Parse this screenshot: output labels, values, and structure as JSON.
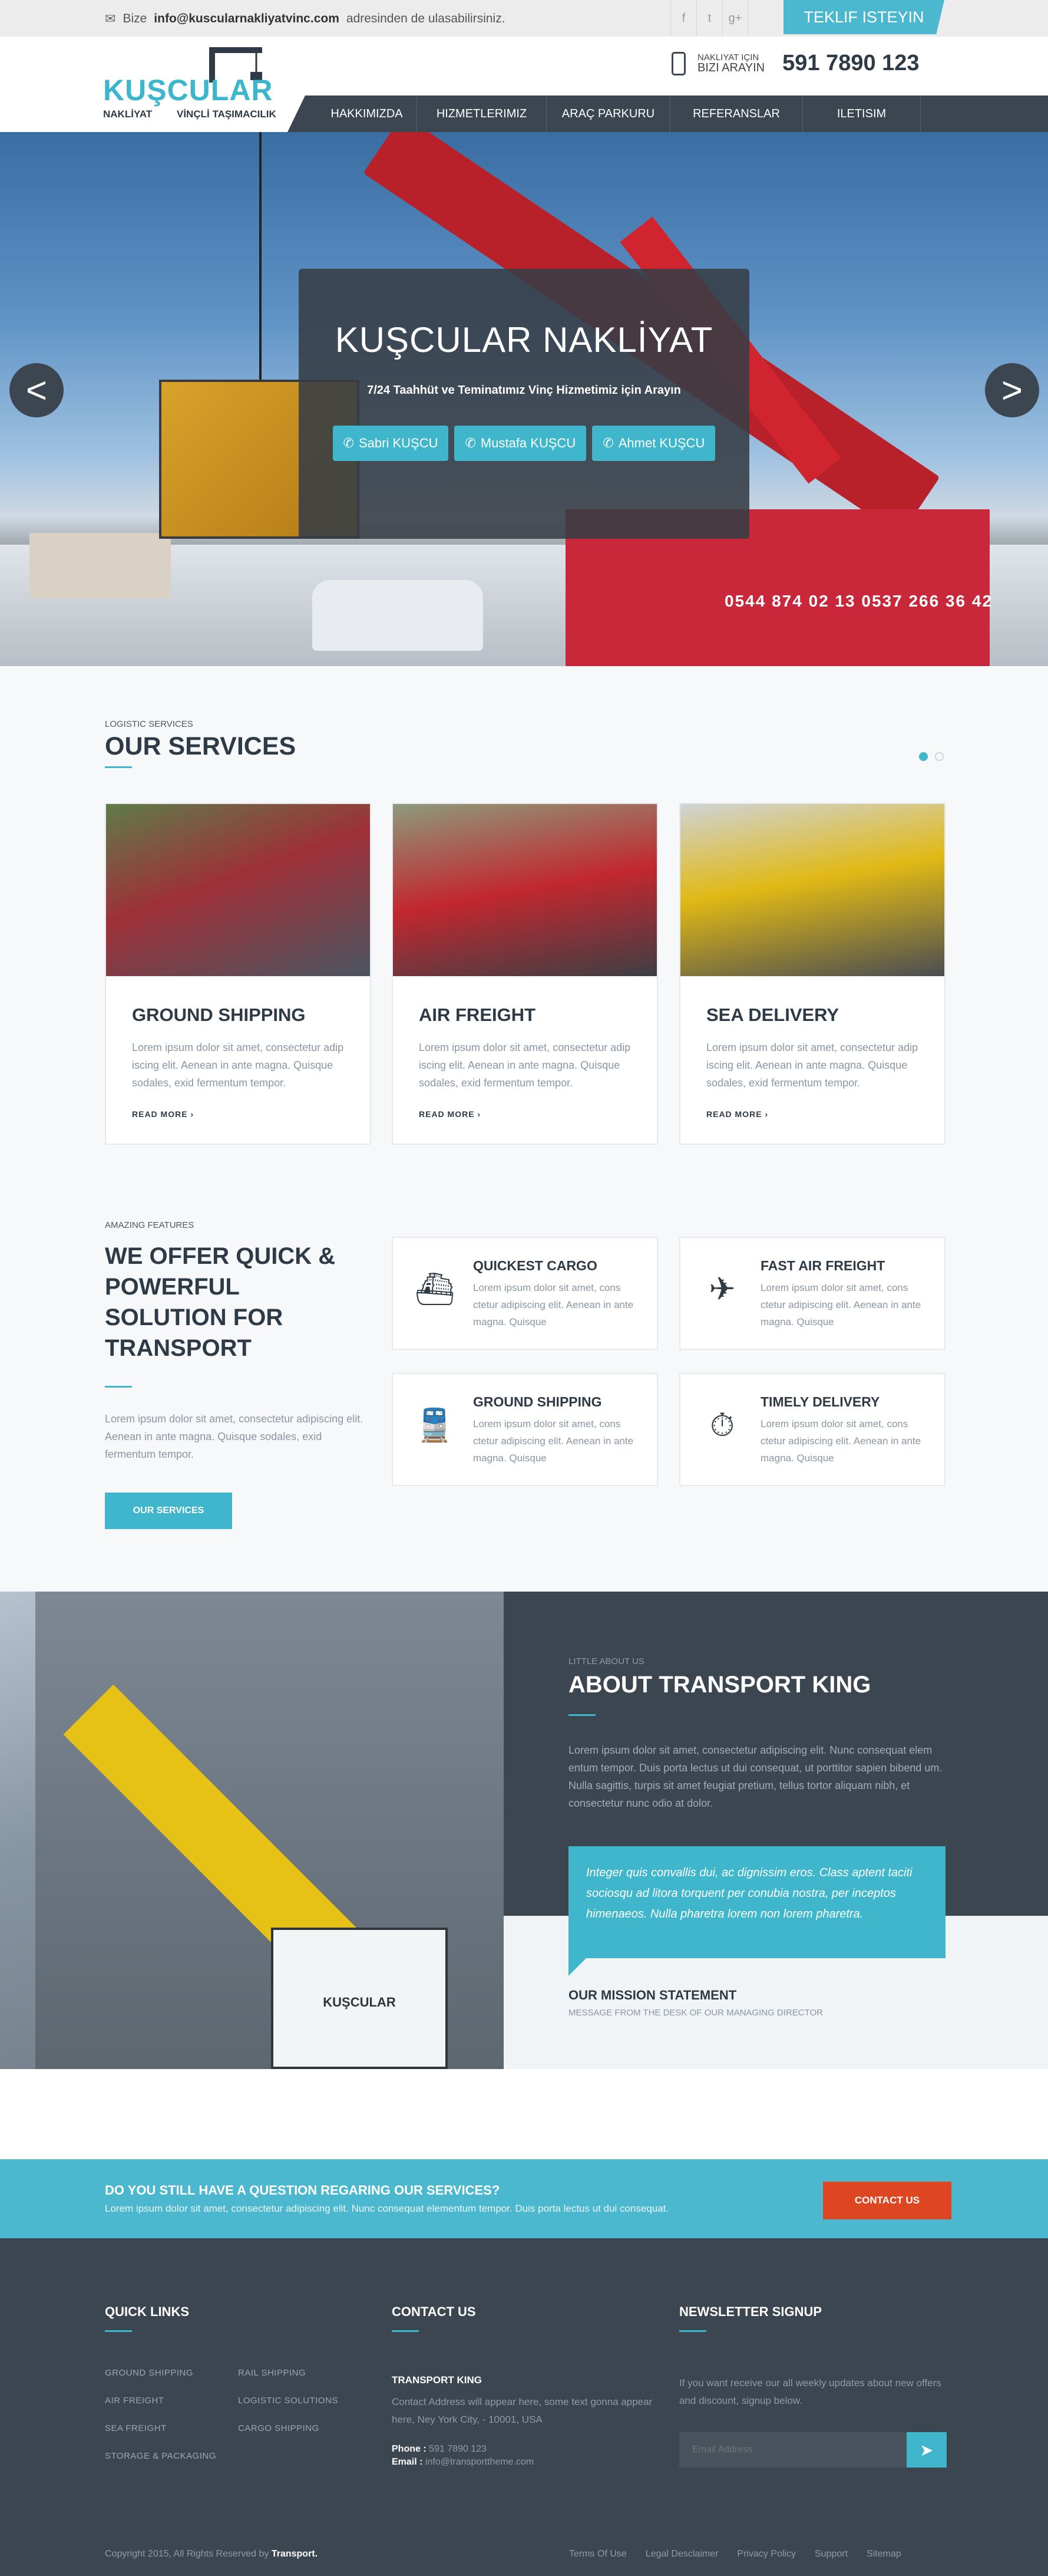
{
  "topbar": {
    "mail_prefix": "Bize",
    "mail_address": "info@kuscularnakliyatvinc.com",
    "mail_suffix": "adresinden de ulasabilirsiniz.",
    "socials": [
      "f",
      "t",
      "g+"
    ],
    "cta_label": "TEKLIF ISTEYIN"
  },
  "header": {
    "logo_name": "KUŞCULAR",
    "logo_sub_left": "NAKLİYAT",
    "logo_sub_right": "VİNÇLİ TAŞIMACILIK",
    "phone_label_1": "NAKLIYAT IÇIN",
    "phone_label_2": "BIZI ARAYIN",
    "phone_number": "591 7890 123"
  },
  "nav": {
    "items": [
      "HAKKIMIZDA",
      "HIZMETLERIMIZ",
      "ARAÇ PARKURU",
      "REFERANSLAR",
      "ILETISIM"
    ]
  },
  "hero": {
    "title": "KUŞCULAR NAKLİYAT",
    "subtitle": "7/24 Taahhüt ve Teminatımız Vinç Hizmetimiz için Arayın",
    "buttons": [
      "Sabri KUŞCU",
      "Mustafa KUŞCU",
      "Ahmet KUŞCU"
    ],
    "plate_text": "0544 874 02 13    0537 266 36 42",
    "prev_label": "<",
    "next_label": ">"
  },
  "services": {
    "kicker": "LOGISTIC SERVICES",
    "title": "OUR SERVICES",
    "cards": [
      {
        "title": "GROUND SHIPPING",
        "text": "Lorem ipsum dolor sit amet, consectetur adip iscing elit. Aenean in ante magna. Quisque sodales, exid fermentum tempor.",
        "more": "READ MORE  ›"
      },
      {
        "title": "AIR FREIGHT",
        "text": "Lorem ipsum dolor sit amet, consectetur adip iscing elit. Aenean in ante magna. Quisque sodales, exid fermentum tempor.",
        "more": "READ MORE  ›"
      },
      {
        "title": "SEA DELIVERY",
        "text": "Lorem ipsum dolor sit amet, consectetur adip iscing elit. Aenean in ante magna. Quisque sodales, exid fermentum tempor.",
        "more": "READ MORE  ›"
      }
    ]
  },
  "features": {
    "kicker": "AMAZING FEATURES",
    "title": "WE OFFER QUICK & POWERFUL SOLUTION FOR TRANSPORT",
    "text": "Lorem ipsum dolor sit amet, consectetur adipiscing elit. Aenean in ante magna. Quisque sodales, exid fermentum tempor.",
    "button": "OUR SERVICES",
    "boxes": [
      {
        "title": "QUICKEST CARGO",
        "text": "Lorem ipsum dolor sit amet, cons ctetur adipiscing elit. Aenean in ante magna. Quisque",
        "icon": "ship-icon"
      },
      {
        "title": "FAST AIR FREIGHT",
        "text": "Lorem ipsum dolor sit amet, cons ctetur adipiscing elit. Aenean in ante magna. Quisque",
        "icon": "plane-icon"
      },
      {
        "title": "GROUND SHIPPING",
        "text": "Lorem ipsum dolor sit amet, cons ctetur adipiscing elit. Aenean in ante magna. Quisque",
        "icon": "train-icon"
      },
      {
        "title": "TIMELY DELIVERY",
        "text": "Lorem ipsum dolor sit amet, cons ctetur adipiscing elit. Aenean in ante magna. Quisque",
        "icon": "stopwatch-icon"
      }
    ]
  },
  "about": {
    "kicker": "LITTLE ABOUT US",
    "title": "ABOUT TRANSPORT KING",
    "text": "Lorem ipsum dolor sit amet, consectetur adipiscing elit. Nunc consequat elem entum tempor. Duis porta lectus ut dui consequat, ut porttitor sapien bibend um. Nulla sagittis, turpis sit amet feugiat pretium, tellus tortor aliquam nibh, et consectetur nunc odio at dolor.",
    "quote": "Integer quis convallis dui, ac dignissim eros. Class aptent taciti sociosqu ad litora torquent per conubia nostra, per inceptos himenaeos. Nulla pharetra lorem non lorem pharetra.",
    "mission_title": "OUR MISSION STATEMENT",
    "mission_sub": "MESSAGE FROM THE DESK OF OUR MANAGING DIRECTOR",
    "photo_label": "KUŞCULAR"
  },
  "cta": {
    "title": "DO YOU STILL HAVE A QUESTION REGARING OUR SERVICES?",
    "text": "Lorem ipsum dolor sit amet, consectetur adipiscing elit. Nunc consequat elementum tempor. Duis porta lectus ut dui consequat.",
    "button": "CONTACT US"
  },
  "footer": {
    "quick_links_title": "QUICK LINKS",
    "links": [
      "GROUND SHIPPING",
      "RAIL SHIPPING",
      "AIR FREIGHT",
      "LOGISTIC SOLUTIONS",
      "SEA FREIGHT",
      "CARGO SHIPPING",
      "STORAGE & PACKAGING"
    ],
    "contact_title": "CONTACT US",
    "org": "TRANSPORT KING",
    "address": "Contact Address will appear here, some text gonna appear here, Ney York City, - 10001, USA",
    "phone_label": "Phone :",
    "phone": "591 7890 123",
    "email_label": "Email :",
    "email": "info@transporttheme.com",
    "newsletter_title": "NEWSLETTER SIGNUP",
    "newsletter_text": "If you want receive our all weekly updates about new offers and discount, signup below.",
    "email_placeholder": "Email Address",
    "copyright_prefix": "Copyright 2015, All Rights Reserved by",
    "copyright_brand": "Transport.",
    "bottom_links": [
      "Terms Of Use",
      "Legal Desclaimer",
      "Privacy Policy",
      "Support",
      "Sitemap"
    ]
  },
  "colors": {
    "accent": "#4bb8cf",
    "dark": "#3b4650",
    "cta_orange": "#dd4620"
  }
}
